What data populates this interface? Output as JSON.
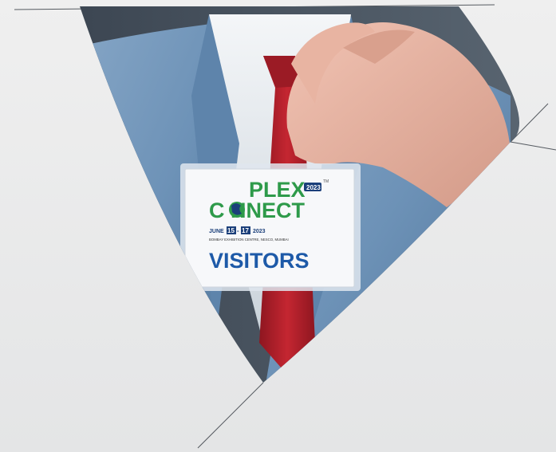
{
  "badge": {
    "brand_top": "PLEX",
    "year_tag": "2023",
    "trademark": "TM",
    "brand_bottom": "C  NNECT",
    "date_prefix": "JUNE",
    "date_start": "15",
    "date_sep": "-",
    "date_end": "17",
    "date_year": "2023",
    "venue": "BOMBAY EXHIBITION CENTRE, NESCO, MUMBAI",
    "role": "VISITORS"
  },
  "colors": {
    "background": "#e9eaeb",
    "brand_green": "#2e9a4a",
    "brand_navy": "#1b3f7a",
    "role_blue": "#1e5aa8",
    "tie_red": "#b0202a",
    "suit_blue": "#6f94b8"
  }
}
